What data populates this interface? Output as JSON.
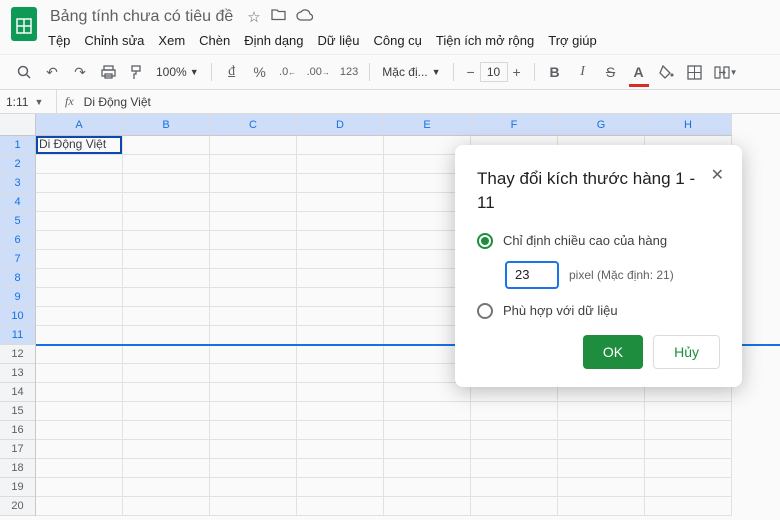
{
  "header": {
    "doc_title": "Bảng tính chưa có tiêu đề",
    "menus": [
      "Tệp",
      "Chỉnh sửa",
      "Xem",
      "Chèn",
      "Định dạng",
      "Dữ liệu",
      "Công cụ",
      "Tiện ích mở rộng",
      "Trợ giúp"
    ]
  },
  "toolbar": {
    "zoom": "100%",
    "font": "Mặc đị...",
    "font_size": "10"
  },
  "namebox": {
    "ref": "1:11",
    "formula": "Di Động Việt"
  },
  "columns": [
    "A",
    "B",
    "C",
    "D",
    "E",
    "F",
    "G",
    "H"
  ],
  "rows": [
    "1",
    "2",
    "3",
    "4",
    "5",
    "6",
    "7",
    "8",
    "9",
    "10",
    "11",
    "12",
    "13",
    "14",
    "15",
    "16",
    "17",
    "18",
    "19",
    "20"
  ],
  "cells": {
    "A1": "Di Động Việt"
  },
  "dialog": {
    "title": "Thay đổi kích thước hàng 1 - 11",
    "opt_specify": "Chỉ định chiều cao của hàng",
    "value": "23",
    "px_label": "pixel (Mặc định: 21)",
    "opt_fit": "Phù hợp với dữ liệu",
    "ok": "OK",
    "cancel": "Hủy"
  }
}
